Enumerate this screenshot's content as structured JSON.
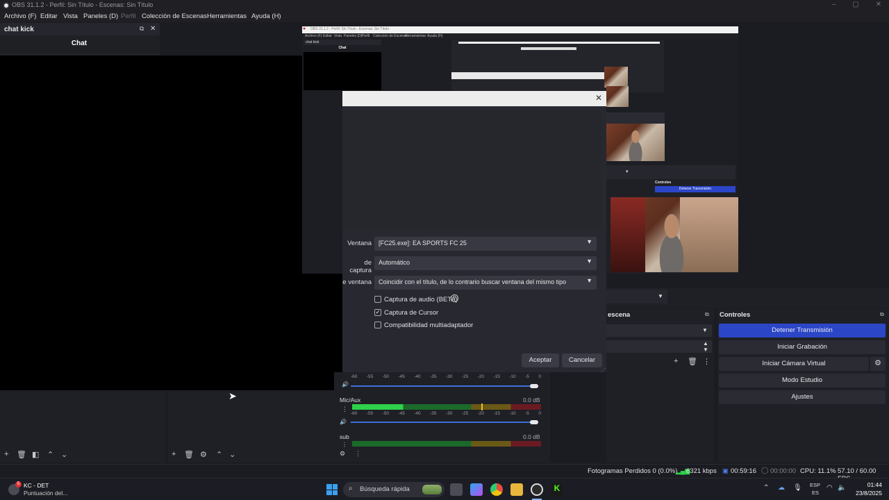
{
  "window": {
    "title": "OBS 31.1.2 - Perfil: Sin Título - Escenas: Sin Título"
  },
  "menu": [
    "Archivo (F)",
    "Editar",
    "Vista",
    "Paneles (D)",
    "Perfil",
    "Colección de Escenas",
    "Herramientas",
    "Ayuda (H)"
  ],
  "chat_dock": {
    "title": "chat kick",
    "panel_heading": "Chat"
  },
  "nested_preview": {
    "menu": [
      "Archivo (F)",
      "Editar",
      "Vista",
      "Paneles (D)",
      "Perfil",
      "Colección de Escenas",
      "Herramientas",
      "Ayuda (H)"
    ],
    "chat_title": "chat kick",
    "chat_heading": "Chat",
    "controls_title": "Controles",
    "stream_button": "Detener Transmisión"
  },
  "dialog": {
    "fields": [
      {
        "label": "Ventana",
        "value": "[FC25.exe]: EA SPORTS FC 25"
      },
      {
        "label": "de captura",
        "value": "Automático"
      },
      {
        "label": "e ventana",
        "value": "Coincidir con el título, de lo contrario buscar ventana del mismo tipo"
      }
    ],
    "checkboxes": [
      {
        "label": "Captura de audio (BETA)",
        "checked": false
      },
      {
        "label": "Captura de Cursor",
        "checked": true
      },
      {
        "label": "Compatibilidad multiadaptador",
        "checked": false
      }
    ],
    "help_glyph": "?",
    "ok_label": "Aceptar",
    "cancel_label": "Cancelar"
  },
  "mixer": {
    "scale": [
      "-60",
      "-55",
      "-50",
      "-45",
      "-40",
      "-35",
      "-30",
      "-25",
      "-20",
      "-15",
      "-10",
      "-5",
      "0"
    ],
    "tracks": [
      {
        "name": "Mic/Aux",
        "db": "0.0 dB",
        "level": 0.27
      },
      {
        "name": "sub",
        "db": "0.0 dB",
        "level": 0
      }
    ]
  },
  "transitions": {
    "title": "escena"
  },
  "controls": {
    "title": "Controles",
    "buttons": [
      "Detener Transmisión",
      "Iniciar Grabación",
      "Iniciar Cámara Virtual",
      "Modo Estudio",
      "Ajustes"
    ]
  },
  "status": {
    "dropped": "Fotogramas Perdidos 0 (0.0%)",
    "bitrate": "6321 kbps",
    "stream_time": "00:59:16",
    "rec_time": "00:00:00",
    "cpu": "CPU: 11.1%",
    "fps": "57.10 / 60.00 FPS"
  },
  "taskbar": {
    "notif_badge": "5",
    "notif_title": "KC - DET",
    "notif_sub": "Puntuación del...",
    "search_placeholder": "Búsqueda rápida",
    "lang_top": "ESP",
    "lang_bottom": "ES",
    "time": "01:44",
    "date": "23/8/2025"
  },
  "colors": {
    "accent": "#2c46c8",
    "meter_green": "#2ed14a",
    "meter_yellow": "#6a5a16",
    "meter_red": "#6b1a22"
  }
}
